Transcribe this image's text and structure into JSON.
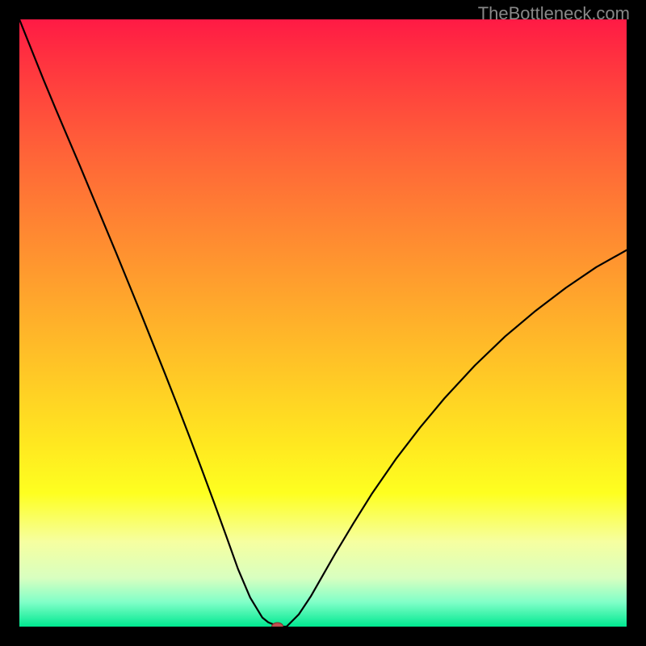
{
  "watermark": "TheBottleneck.com",
  "chart_data": {
    "type": "line",
    "title": "",
    "xlabel": "",
    "ylabel": "",
    "xlim": [
      0,
      100
    ],
    "ylim": [
      0,
      100
    ],
    "x_min_at": 42.5,
    "series": [
      {
        "name": "curve",
        "x": [
          0,
          2,
          4,
          6,
          8,
          10,
          12,
          14,
          16,
          18,
          20,
          22,
          24,
          26,
          28,
          30,
          32,
          34,
          36,
          38,
          40,
          41,
          42,
          42.5,
          43,
          44,
          46,
          48,
          50,
          52,
          55,
          58,
          62,
          66,
          70,
          75,
          80,
          85,
          90,
          95,
          100
        ],
        "y": [
          100,
          95,
          90,
          85.2,
          80.5,
          75.8,
          71,
          66.2,
          61.4,
          56.5,
          51.6,
          46.6,
          41.6,
          36.5,
          31.3,
          26.0,
          20.6,
          15.1,
          9.5,
          4.8,
          1.5,
          0.7,
          0.3,
          0.0,
          0.0,
          0.0,
          2.0,
          5.0,
          8.5,
          12.0,
          17.0,
          21.8,
          27.6,
          32.8,
          37.6,
          43.0,
          47.8,
          52.0,
          55.8,
          59.2,
          62.0
        ]
      }
    ],
    "marker": {
      "x": 42.5,
      "y": 0.0,
      "color": "#c05050"
    },
    "background_gradient": [
      "#ff1a45",
      "#ffbc28",
      "#feff20",
      "#00e890"
    ]
  }
}
